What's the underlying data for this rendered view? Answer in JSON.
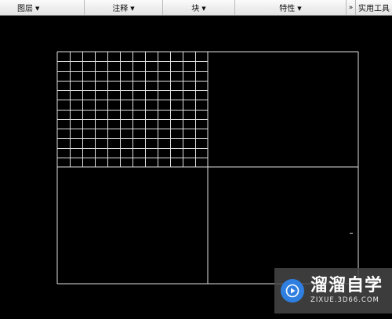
{
  "ribbon": {
    "panels": [
      {
        "label": "图层"
      },
      {
        "label": "注释"
      },
      {
        "label": "块"
      },
      {
        "label": "特性"
      },
      {
        "label": "实用工具"
      }
    ],
    "overflow_glyph": "»"
  },
  "drawing": {
    "line_color": "#e0e0e0",
    "background": "#000000",
    "grid_rows": 12,
    "grid_cols": 12
  },
  "watermark": {
    "logo_text": "溜溜自学",
    "url": "ZIXUE.3D66.COM"
  }
}
